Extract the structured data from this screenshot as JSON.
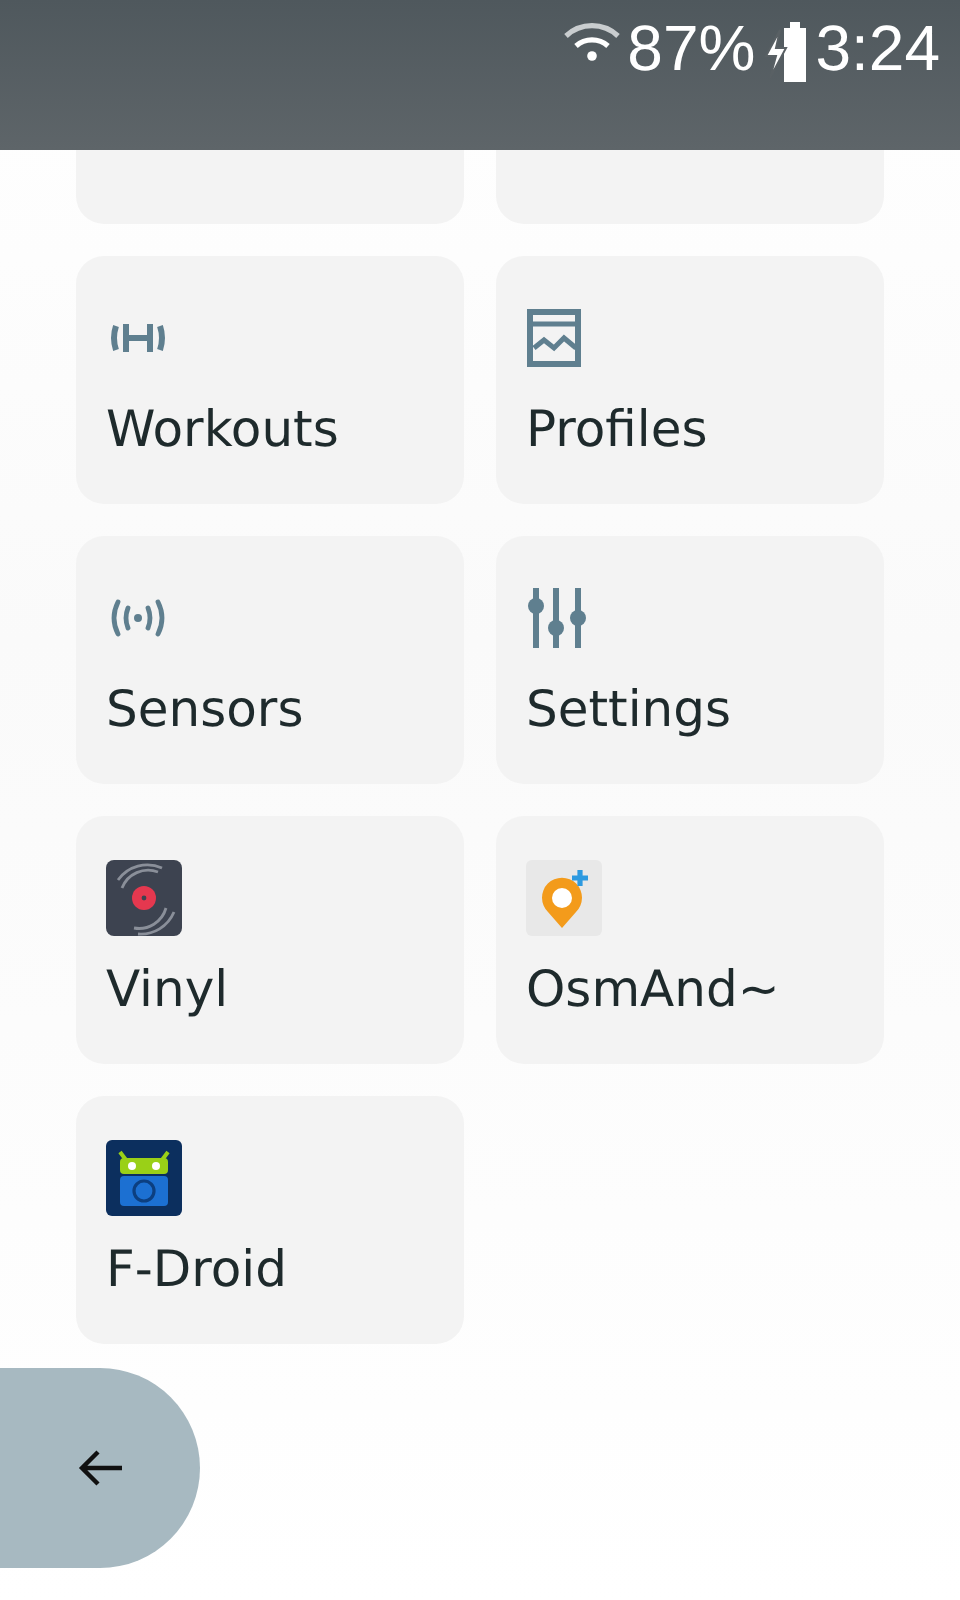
{
  "status_bar": {
    "battery": "87%",
    "time": "3:24"
  },
  "tiles": [
    {
      "label": "Workouts"
    },
    {
      "label": "Profiles"
    },
    {
      "label": "Sensors"
    },
    {
      "label": "Settings"
    },
    {
      "label": "Vinyl"
    },
    {
      "label": "OsmAnd~"
    },
    {
      "label": "F-Droid"
    }
  ]
}
